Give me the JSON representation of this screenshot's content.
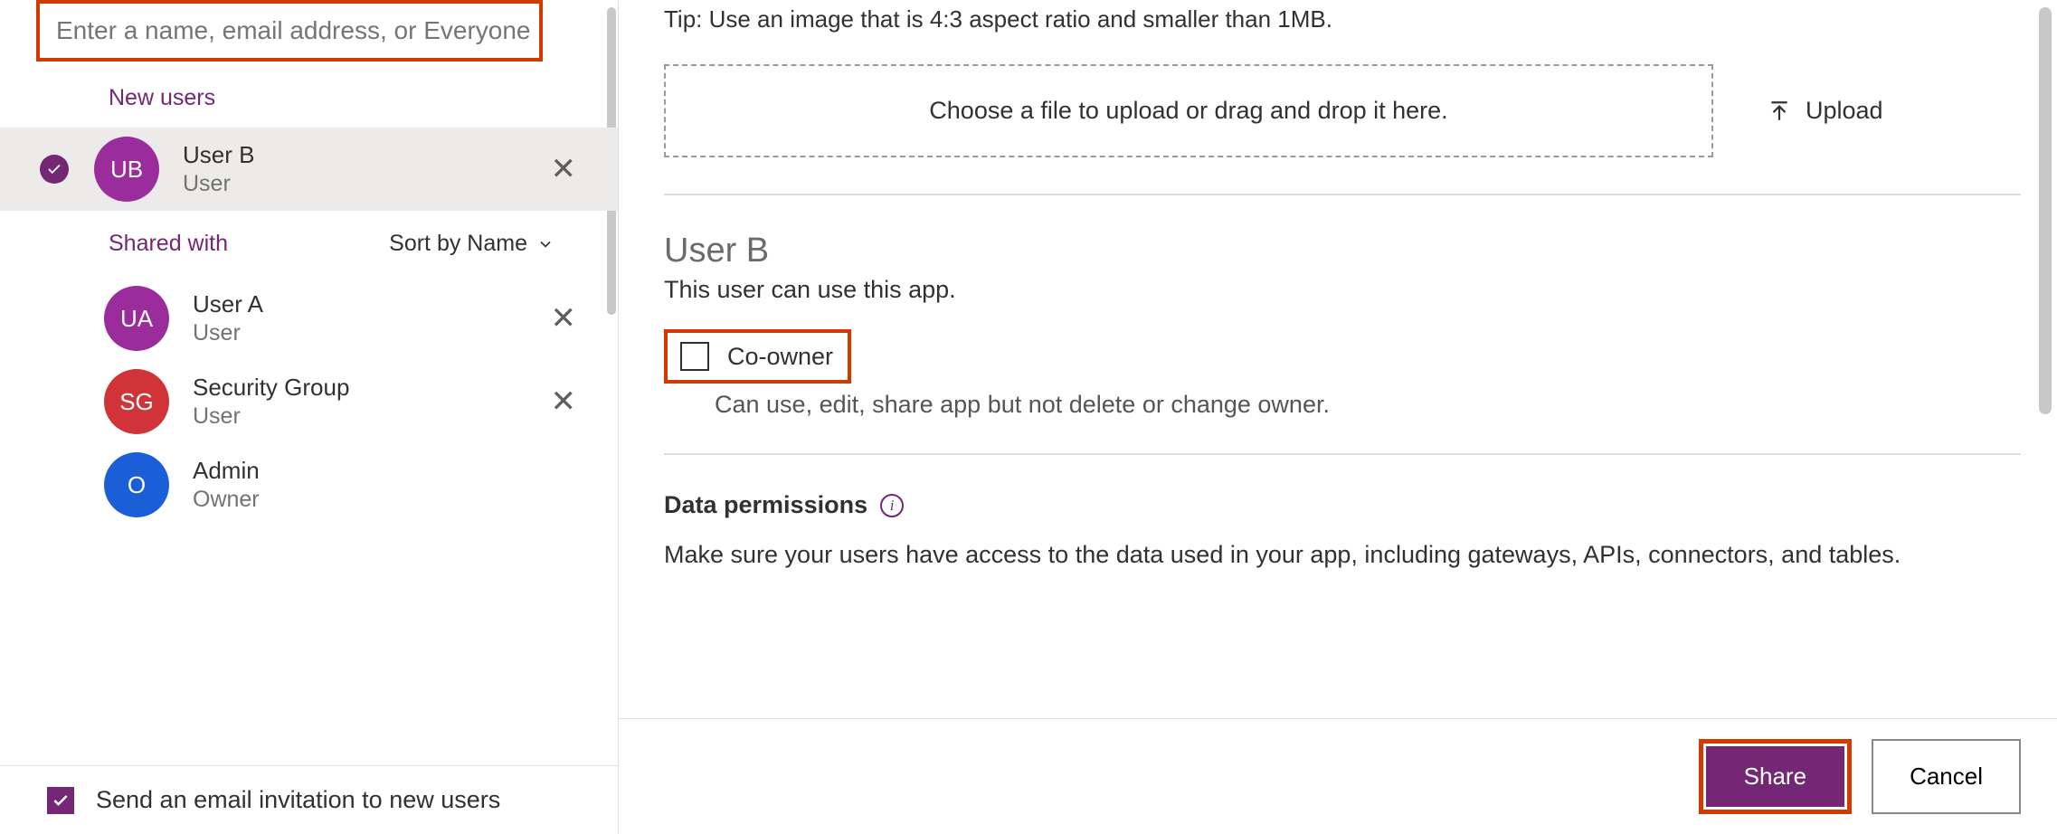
{
  "search": {
    "placeholder": "Enter a name, email address, or Everyone"
  },
  "newUsersLabel": "New users",
  "sharedWithLabel": "Shared with",
  "sortByLabel": "Sort by Name",
  "sendEmailLabel": "Send an email invitation to new users",
  "tipText": "Tip: Use an image that is 4:3 aspect ratio and smaller than 1MB.",
  "dropzoneText": "Choose a file to upload or drag and drop it here.",
  "uploadLabel": "Upload",
  "selectedUser": {
    "name": "User B",
    "desc": "This user can use this app."
  },
  "coowner": {
    "label": "Co-owner",
    "desc": "Can use, edit, share app but not delete or change owner."
  },
  "dataPerm": {
    "label": "Data permissions",
    "desc": "Make sure your users have access to the data used in your app, including gateways, APIs, connectors, and tables."
  },
  "buttons": {
    "share": "Share",
    "cancel": "Cancel"
  },
  "newUsers": [
    {
      "initials": "UB",
      "name": "User B",
      "role": "User",
      "avatarClass": "purple"
    }
  ],
  "sharedUsers": [
    {
      "initials": "UA",
      "name": "User A",
      "role": "User",
      "avatarClass": "purple2",
      "removable": true
    },
    {
      "initials": "SG",
      "name": "Security Group",
      "role": "User",
      "avatarClass": "red",
      "removable": true
    },
    {
      "initials": "O",
      "name": "Admin",
      "role": "Owner",
      "avatarClass": "blue",
      "removable": false
    }
  ]
}
